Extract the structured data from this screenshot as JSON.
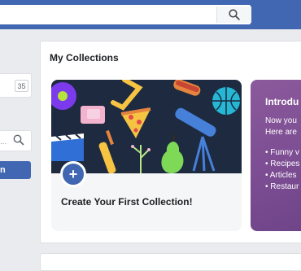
{
  "search": {
    "placeholder": ""
  },
  "left": {
    "count_badge": "35",
    "filter_placeholder": "...",
    "button_label": "n"
  },
  "collections": {
    "title": "My Collections",
    "create_card": {
      "label": "Create Your First Collection!",
      "add_symbol": "+"
    },
    "intro_card": {
      "title": "Introdu",
      "line1": "Now you",
      "line2": "Here are",
      "bullets": [
        "• Funny v",
        "• Recipes",
        "• Articles",
        "• Restaur"
      ]
    }
  },
  "colors": {
    "brand": "#4267b2",
    "intro_card": "#7b4c92",
    "art_bg": "#1d2a3f"
  },
  "icons": {
    "search": "search-icon",
    "add": "plus-icon"
  }
}
